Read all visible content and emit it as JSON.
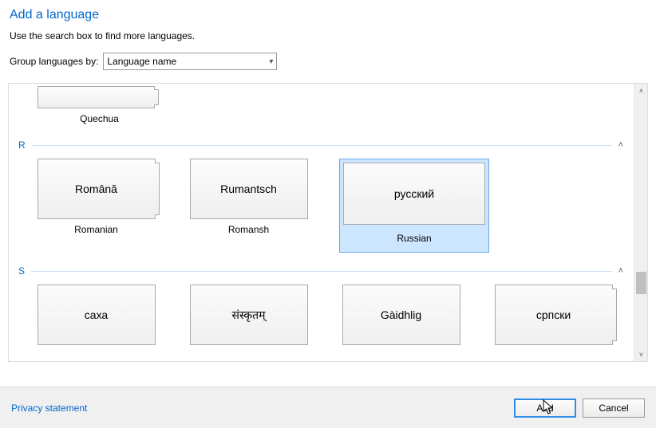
{
  "title": "Add a language",
  "subtitle": "Use the search box to find more languages.",
  "group_label": "Group languages by:",
  "group_value": "Language name",
  "prev_group": {
    "item_label": "Quechua"
  },
  "sections": {
    "r": {
      "letter": "R",
      "items": [
        {
          "native": "Română",
          "english": "Romanian"
        },
        {
          "native": "Rumantsch",
          "english": "Romansh"
        },
        {
          "native": "русский",
          "english": "Russian"
        }
      ]
    },
    "s": {
      "letter": "S",
      "items": [
        {
          "native": "саха"
        },
        {
          "native": "संस्कृतम्"
        },
        {
          "native": "Gàidhlig"
        },
        {
          "native": "српски"
        }
      ]
    }
  },
  "footer": {
    "privacy": "Privacy statement",
    "add": "Add",
    "cancel": "Cancel"
  }
}
